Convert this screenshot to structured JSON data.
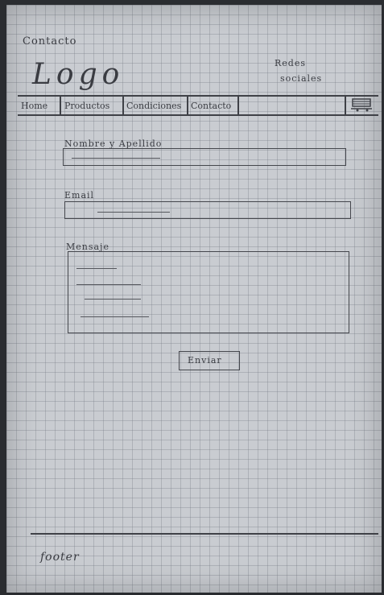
{
  "page": {
    "header_label": "Contacto",
    "logo": "Logo",
    "social_line1": "Redes",
    "social_line2": "sociales",
    "footer": "footer"
  },
  "nav": {
    "items": [
      "Home",
      "Productos",
      "Condiciones",
      "Contacto"
    ]
  },
  "form": {
    "name_label": "Nombre y Apellido",
    "email_label": "Email",
    "message_label": "Mensaje",
    "submit_label": "Enviar"
  },
  "colors": {
    "paper": "#c9ccd1",
    "ink": "#3a3c42"
  }
}
